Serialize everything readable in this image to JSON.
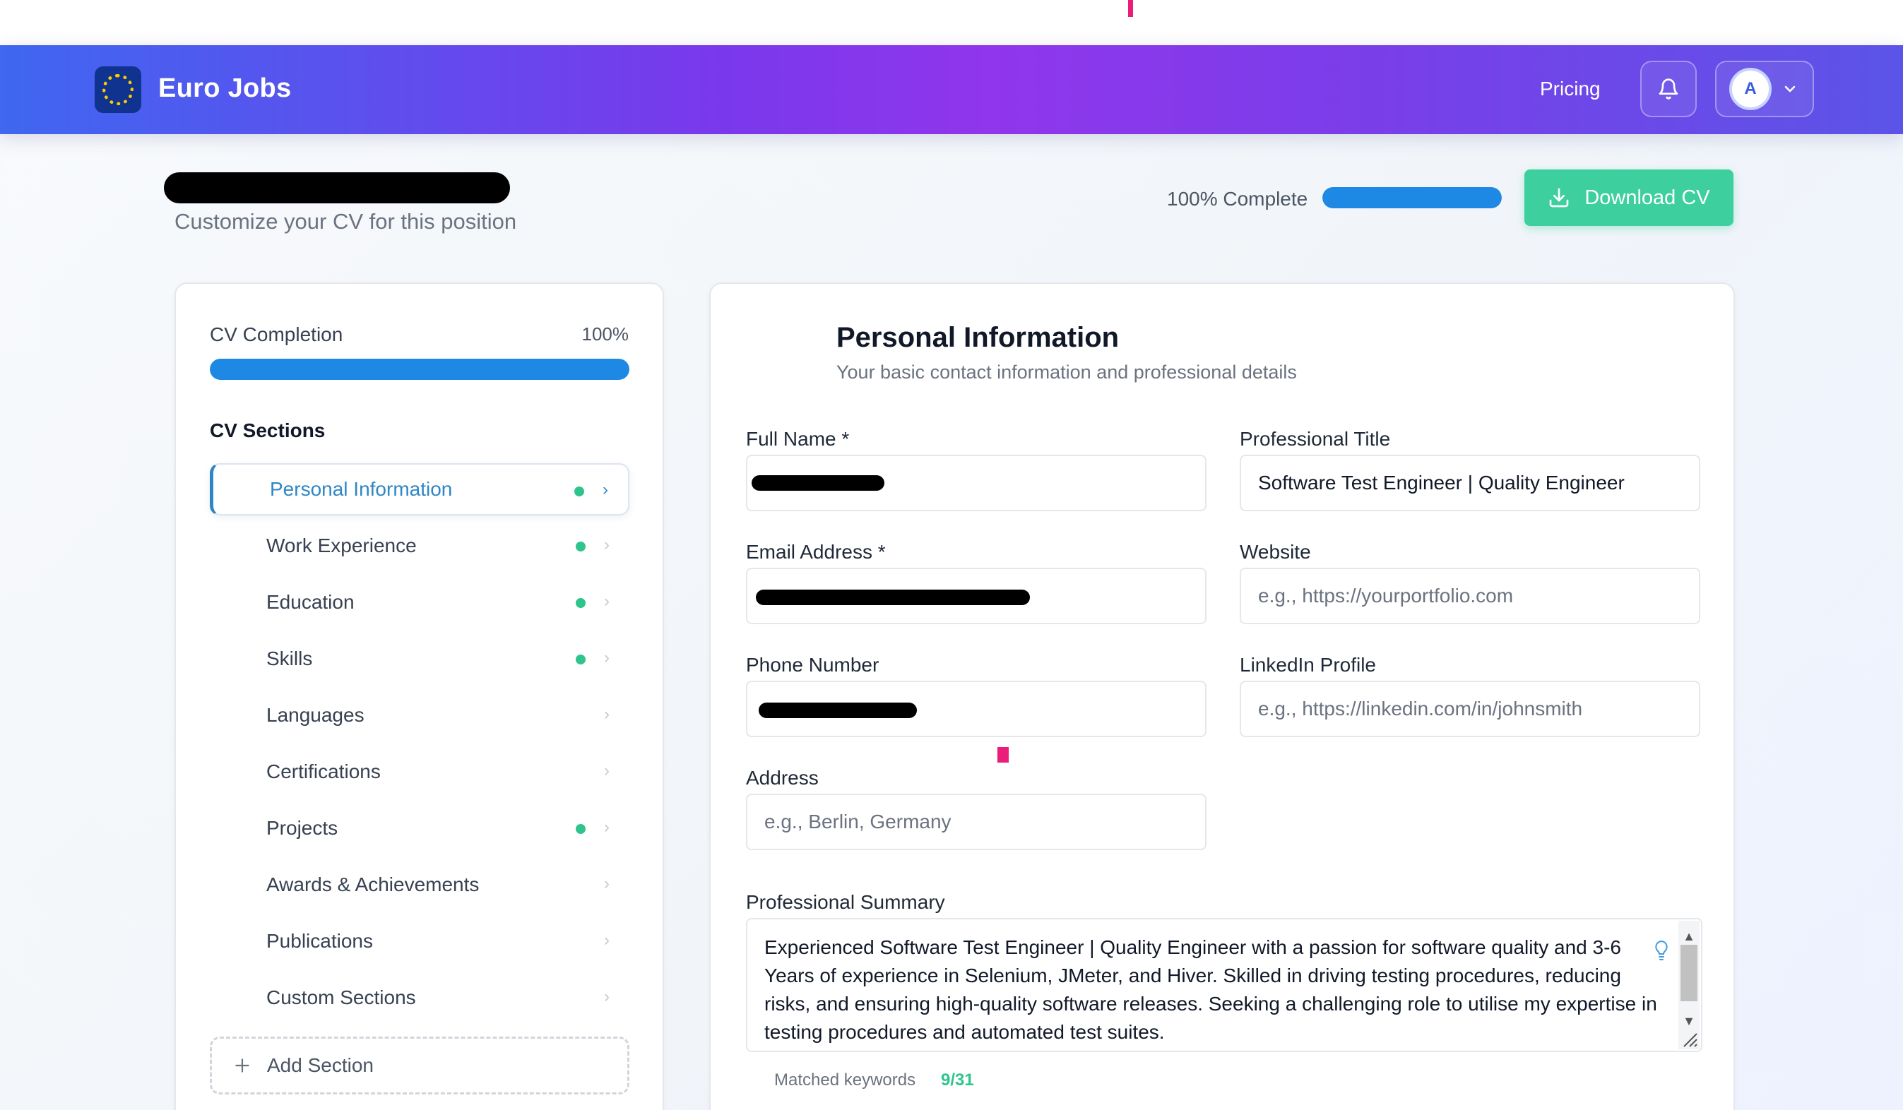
{
  "header": {
    "brand": "Euro Jobs",
    "nav_pricing": "Pricing",
    "avatar_initial": "A",
    "icons": [
      "eu-stars-logo-icon",
      "bell-icon",
      "chevron-down-icon"
    ]
  },
  "page": {
    "subtitle": "Customize your CV for this position",
    "completion_text": "100% Complete",
    "completion_fraction": 1.0,
    "download_label": "Download CV"
  },
  "sidebar": {
    "completion_label": "CV Completion",
    "completion_pct": "100%",
    "completion_fraction": 1.0,
    "sections_title": "CV Sections",
    "items": [
      {
        "label": "Personal Information",
        "complete": true,
        "active": true
      },
      {
        "label": "Work Experience",
        "complete": true,
        "active": false
      },
      {
        "label": "Education",
        "complete": true,
        "active": false
      },
      {
        "label": "Skills",
        "complete": true,
        "active": false
      },
      {
        "label": "Languages",
        "complete": false,
        "active": false
      },
      {
        "label": "Certifications",
        "complete": false,
        "active": false
      },
      {
        "label": "Projects",
        "complete": true,
        "active": false
      },
      {
        "label": "Awards & Achievements",
        "complete": false,
        "active": false
      },
      {
        "label": "Publications",
        "complete": false,
        "active": false
      },
      {
        "label": "Custom Sections",
        "complete": false,
        "active": false
      }
    ],
    "add_section_label": "Add Section"
  },
  "form": {
    "title": "Personal Information",
    "subtitle": "Your basic contact information and professional details",
    "full_name_label": "Full Name *",
    "professional_title_label": "Professional Title",
    "professional_title_value": "Software Test Engineer | Quality Engineer",
    "email_label": "Email Address *",
    "website_label": "Website",
    "website_placeholder": "e.g., https://yourportfolio.com",
    "phone_label": "Phone Number",
    "linkedin_label": "LinkedIn Profile",
    "linkedin_placeholder": "e.g., https://linkedin.com/in/johnsmith",
    "address_label": "Address",
    "address_placeholder": "e.g., Berlin, Germany",
    "summary_label": "Professional Summary",
    "summary_value": "Experienced Software Test Engineer | Quality Engineer with a passion for software quality and 3-6 Years of experience in Selenium, JMeter, and Hiver. Skilled in driving testing procedures, reducing risks, and ensuring high-quality software releases. Seeking a challenging role to utilise my expertise in testing procedures and automated test suites.",
    "matched_keywords_label": "Matched keywords",
    "matched_keywords_value": "9/31"
  },
  "colors": {
    "accent_blue": "#1e88e5",
    "success_green": "#3ecf9e",
    "active_text": "#2f86c6"
  }
}
